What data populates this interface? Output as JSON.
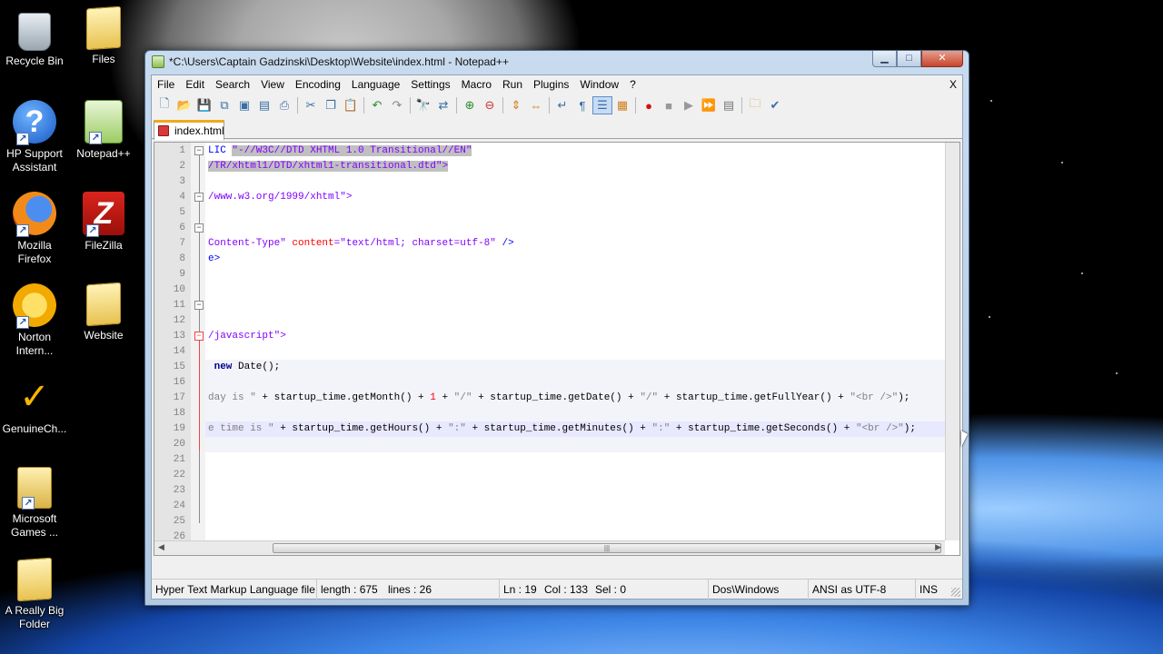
{
  "desktop": {
    "icons": [
      {
        "label": "Recycle Bin",
        "icon": "recycle-bin-icon"
      },
      {
        "label": "Files",
        "icon": "folder-icon"
      },
      {
        "label": "HP Support Assistant",
        "icon": "help-icon"
      },
      {
        "label": "Notepad++",
        "icon": "notepad-plus-plus-icon"
      },
      {
        "label": "Mozilla Firefox",
        "icon": "firefox-icon"
      },
      {
        "label": "FileZilla",
        "icon": "filezilla-icon"
      },
      {
        "label": "Norton Intern...",
        "icon": "norton-icon"
      },
      {
        "label": "Website",
        "icon": "folder-icon"
      },
      {
        "label": "GenuineCh...",
        "icon": "genuine-check-icon"
      },
      {
        "label": "Microsoft Games ...",
        "icon": "games-folder-icon"
      },
      {
        "label": "A Really Big Folder",
        "icon": "folder-icon"
      }
    ]
  },
  "window": {
    "title": "*C:\\Users\\Captain Gadzinski\\Desktop\\Website\\index.html - Notepad++",
    "controls": {
      "minimize": "▁",
      "maximize": "□",
      "close": "✕"
    }
  },
  "menubar": {
    "items": [
      "File",
      "Edit",
      "Search",
      "View",
      "Encoding",
      "Language",
      "Settings",
      "Macro",
      "Run",
      "Plugins",
      "Window",
      "?"
    ],
    "close_doc": "X"
  },
  "toolbar": {
    "buttons": [
      "new-file-icon",
      "open-file-icon",
      "save-icon",
      "save-all-icon",
      "close-icon",
      "close-all-icon",
      "print-icon",
      "cut-icon",
      "copy-icon",
      "paste-icon",
      "undo-icon",
      "redo-icon",
      "find-icon",
      "replace-icon",
      "zoom-in-icon",
      "zoom-out-icon",
      "sync-v-icon",
      "sync-h-icon",
      "wrap-icon",
      "all-chars-icon",
      "indent-guide-icon",
      "user-lang-icon",
      "record-macro-icon",
      "stop-macro-icon",
      "play-macro-icon",
      "run-macro-multiple-icon",
      "save-macro-icon",
      "open-folder-icon",
      "spellcheck-icon"
    ]
  },
  "tab": {
    "label": "index.html"
  },
  "editor": {
    "lines": [
      {
        "n": "1"
      },
      {
        "n": "2"
      },
      {
        "n": "3"
      },
      {
        "n": "4"
      },
      {
        "n": "5"
      },
      {
        "n": "6"
      },
      {
        "n": "7"
      },
      {
        "n": "8"
      },
      {
        "n": "9"
      },
      {
        "n": "10"
      },
      {
        "n": "11"
      },
      {
        "n": "12"
      },
      {
        "n": "13"
      },
      {
        "n": "14"
      },
      {
        "n": "15"
      },
      {
        "n": "16"
      },
      {
        "n": "17"
      },
      {
        "n": "18"
      },
      {
        "n": "19"
      },
      {
        "n": "20"
      },
      {
        "n": "21"
      },
      {
        "n": "22"
      },
      {
        "n": "23"
      },
      {
        "n": "24"
      },
      {
        "n": "25"
      },
      {
        "n": "26"
      }
    ],
    "code": {
      "l1_a": "LIC ",
      "l1_b": "\"-//W3C//DTD XHTML 1.0 Transitional//EN\"",
      "l2": "/TR/xhtml1/DTD/xhtml1-transitional.dtd\">",
      "l4": "/www.w3.org/1999/xhtml\">",
      "l7_a": "Content-Type\"",
      "l7_b": " content",
      "l7_c": "=\"text/html; charset=utf-8\"",
      "l7_d": " />",
      "l8": "e>",
      "l13": "/javascript\">",
      "l15_a": " new",
      "l15_b": " Date();",
      "l17_a": "day is \"",
      "l17_b": " + startup_time.getMonth() + ",
      "l17_c": "1",
      "l17_d": " + ",
      "l17_e": "\"/\"",
      "l17_f": " + startup_time.getDate() + ",
      "l17_g": "\"/\"",
      "l17_h": " + startup_time.getFullYear() + ",
      "l17_i": "\"<br />\"",
      "l17_j": ");",
      "l19_a": "e time is \"",
      "l19_b": " + startup_time.getHours() + ",
      "l19_c": "\":\"",
      "l19_d": " + startup_time.getMinutes() + ",
      "l19_e": "\":\"",
      "l19_f": " + startup_time.getSeconds() + ",
      "l19_g": "\"<br />\"",
      "l19_h": ");"
    },
    "hscroll_grip": "|||"
  },
  "statusbar": {
    "filetype": "Hyper Text Markup Language file",
    "length": "length : 675",
    "lines": "lines : 26",
    "ln": "Ln : 19",
    "col": "Col : 133",
    "sel": "Sel : 0",
    "eol": "Dos\\Windows",
    "encoding": "ANSI as UTF-8",
    "mode": "INS"
  },
  "colors": {
    "tag": "#0000ff",
    "attribute": "#ff0000",
    "value": "#8000ff",
    "string": "#808080",
    "active_tab": "#f0a81c"
  }
}
